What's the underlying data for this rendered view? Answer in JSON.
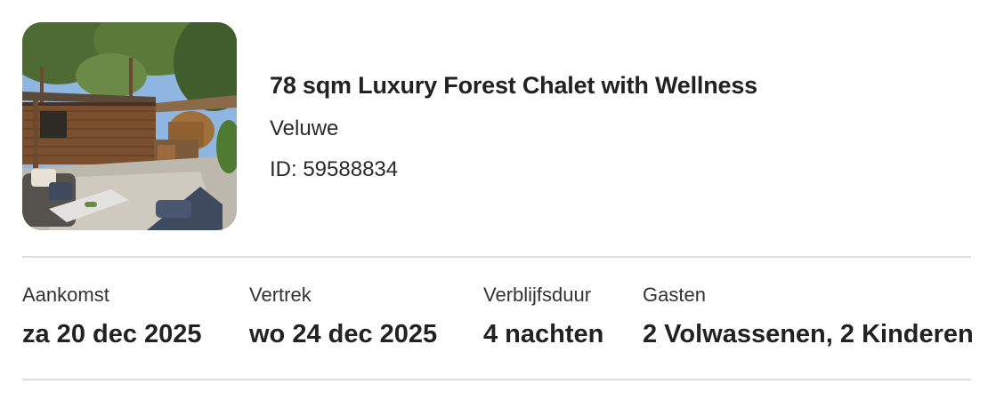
{
  "listing": {
    "image_alt": "Chalet terrace with hot tub and garden furniture",
    "title": "78 sqm Luxury Forest Chalet with Wellness",
    "location": "Veluwe",
    "id_text": "ID: 59588834"
  },
  "booking": {
    "arrival": {
      "label": "Aankomst",
      "value": "za 20 dec 2025"
    },
    "departure": {
      "label": "Vertrek",
      "value": "wo 24 dec 2025"
    },
    "duration": {
      "label": "Verblijfsduur",
      "value": "4 nachten"
    },
    "guests": {
      "label": "Gasten",
      "value": "2 Volwassenen, 2 Kinderen"
    }
  },
  "colors": {
    "text": "#222222",
    "divider": "#dddddd",
    "background": "#ffffff"
  }
}
